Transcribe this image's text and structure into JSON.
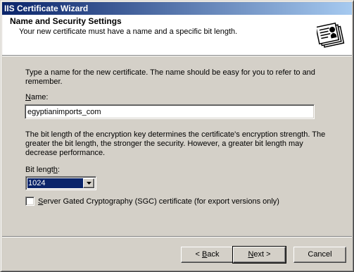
{
  "window": {
    "title": "IIS Certificate Wizard"
  },
  "header": {
    "title": "Name and Security Settings",
    "subtitle": "Your new certificate must have a name and a specific bit length.",
    "icon": "certificate-icon"
  },
  "body": {
    "intro": "Type a name for the new certificate. The name should be easy for you to refer to and remember.",
    "name_label_accel": "N",
    "name_label_rest": "ame:",
    "name_value": "egyptianimports_com",
    "bitlength_desc": "The bit length of the encryption key determines the certificate's encryption strength. The greater the bit length, the stronger the security.  However, a greater bit length may decrease performance.",
    "bitlength_label_pre": "Bit lengt",
    "bitlength_label_accel": "h",
    "bitlength_label_post": ":",
    "bitlength_value": "1024",
    "sgc_accel": "S",
    "sgc_rest": "erver Gated Cryptography (SGC) certificate (for export versions only)",
    "sgc_checked": false
  },
  "buttons": {
    "back_prefix": "< ",
    "back_accel": "B",
    "back_rest": "ack",
    "next_accel": "N",
    "next_rest": "ext >",
    "cancel": "Cancel"
  }
}
